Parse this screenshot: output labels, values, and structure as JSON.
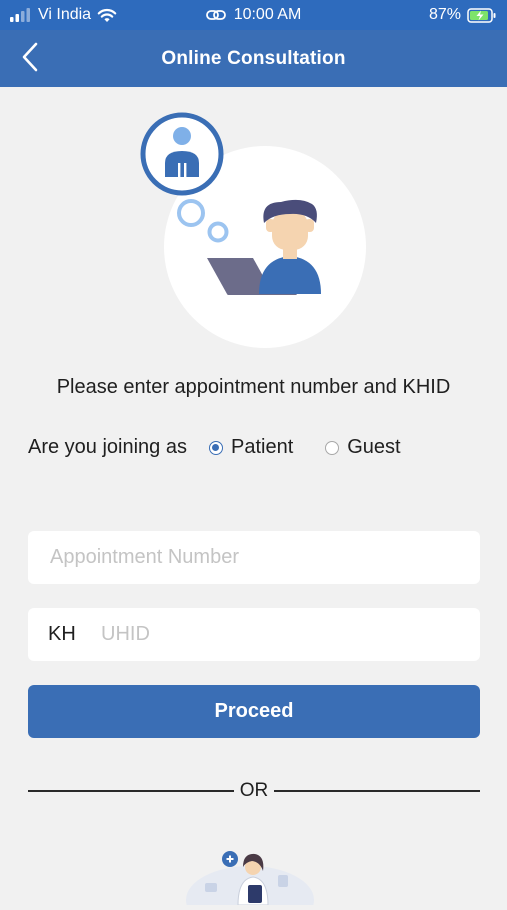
{
  "status_bar": {
    "carrier": "Vi India",
    "time": "10:00 AM",
    "battery": "87%"
  },
  "nav": {
    "title": "Online Consultation"
  },
  "prompt": {
    "text": "Please enter appointment number and KHID"
  },
  "join": {
    "label": "Are you joining as",
    "options": [
      {
        "label": "Patient",
        "selected": true
      },
      {
        "label": "Guest",
        "selected": false
      }
    ]
  },
  "form": {
    "appointment_placeholder": "Appointment Number",
    "appointment_value": "",
    "uhid_prefix": "KH",
    "uhid_placeholder": "UHID",
    "uhid_value": "",
    "proceed_label": "Proceed"
  },
  "divider": {
    "label": "OR"
  },
  "colors": {
    "primary": "#3a6eb5",
    "status_bar": "#2e6bbd",
    "background": "#f1f1f1"
  }
}
